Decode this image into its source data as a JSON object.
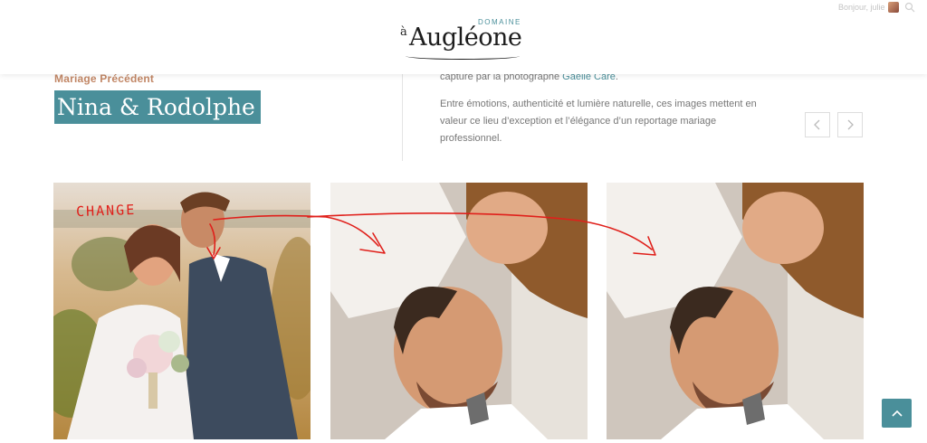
{
  "header": {
    "logo_prefix": "à",
    "logo_sub": "DOMAINE",
    "logo_name": "Augléone",
    "user_greeting": "Bonjour, julie",
    "icons": [
      "user-avatar",
      "search-icon"
    ]
  },
  "intro": {
    "previous_label": "Mariage Précédent",
    "couple_name": "Nina & Rodolphe",
    "text_line1_prefix": "capture par la photographe ",
    "photographer": "Gaelle Care",
    "text_line1_suffix": ".",
    "paragraph2": "Entre émotions, authenticité et lumière naturelle, ces images mettent en valeur ce lieu d’exception et l’élégance d’un reportage mariage professionnel."
  },
  "navigation": {
    "prev_icon": "chevron-left-icon",
    "next_icon": "chevron-right-icon"
  },
  "gallery": {
    "photos": [
      {
        "name": "couple-field-photo"
      },
      {
        "name": "couple-closeup-photo"
      },
      {
        "name": "couple-closeup-photo-duplicate"
      }
    ]
  },
  "annotation": {
    "text": "CHANGE",
    "color": "#e0201b"
  },
  "colors": {
    "accent": "#4a8f9a",
    "label": "#c28766",
    "body_text": "#777777"
  },
  "scroll_top_icon": "chevron-up-icon"
}
